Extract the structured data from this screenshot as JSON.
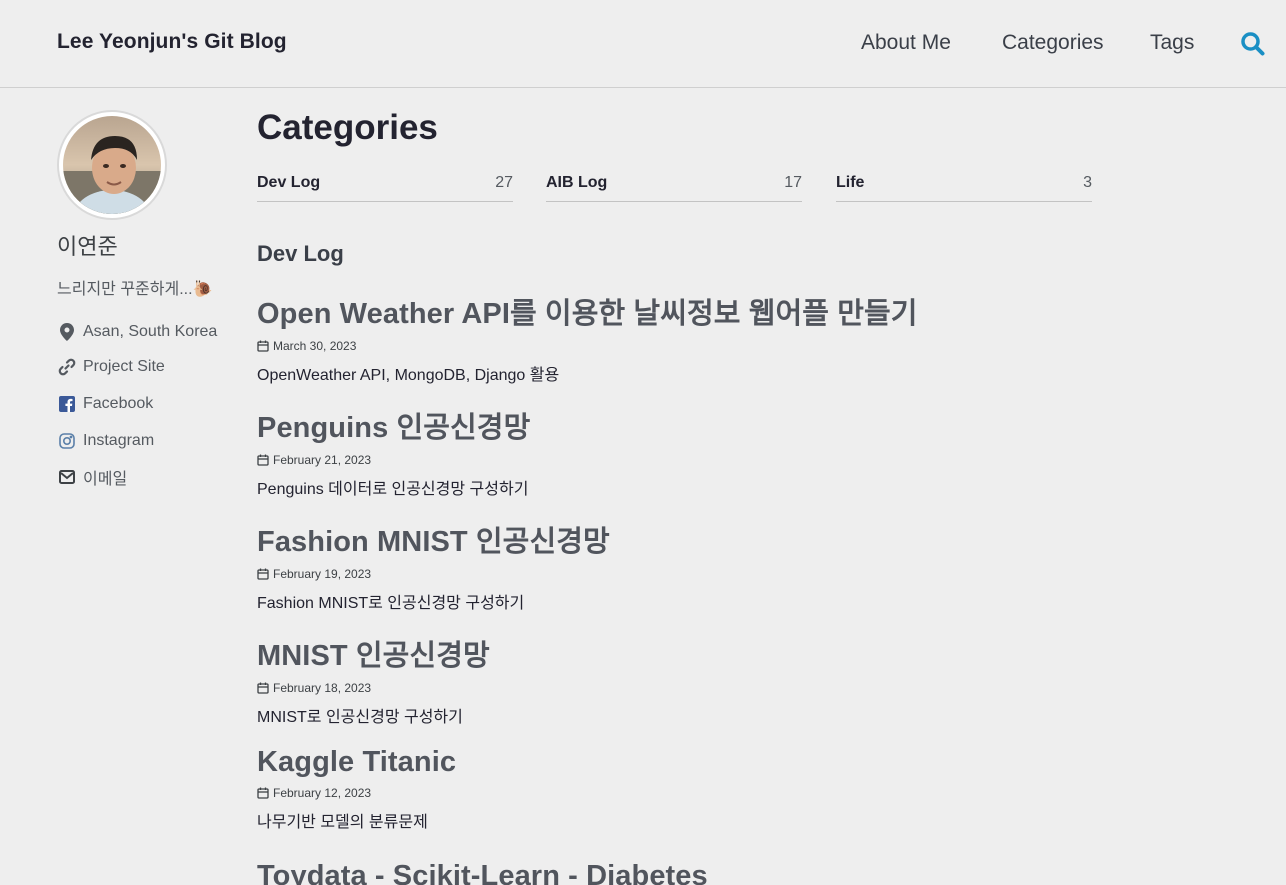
{
  "site": {
    "title": "Lee Yeonjun's Git Blog",
    "nav": [
      "About Me",
      "Categories",
      "Tags"
    ],
    "accent_color": "#1a8fc4"
  },
  "author": {
    "name": "이연준",
    "bio": "느리지만 꾸준하게...🐌",
    "links": [
      {
        "icon": "map-marker-icon",
        "label": "Asan, South Korea"
      },
      {
        "icon": "link-icon",
        "label": "Project Site"
      },
      {
        "icon": "facebook-icon",
        "label": "Facebook"
      },
      {
        "icon": "instagram-icon",
        "label": "Instagram"
      },
      {
        "icon": "envelope-icon",
        "label": "이메일"
      }
    ]
  },
  "page": {
    "title": "Categories",
    "categories": [
      {
        "name": "Dev Log",
        "count": "27"
      },
      {
        "name": "AIB Log",
        "count": "17"
      },
      {
        "name": "Life",
        "count": "3"
      }
    ],
    "section_title": "Dev Log",
    "posts": [
      {
        "title": "Open Weather API를 이용한 날씨정보 웹어플 만들기",
        "date": "March 30, 2023",
        "excerpt": "OpenWeather API, MongoDB, Django 활용"
      },
      {
        "title": "Penguins 인공신경망",
        "date": "February 21, 2023",
        "excerpt": "Penguins 데이터로 인공신경망 구성하기"
      },
      {
        "title": "Fashion MNIST 인공신경망",
        "date": "February 19, 2023",
        "excerpt": "Fashion MNIST로 인공신경망 구성하기"
      },
      {
        "title": "MNIST 인공신경망",
        "date": "February 18, 2023",
        "excerpt": "MNIST로 인공신경망 구성하기"
      },
      {
        "title": "Kaggle Titanic",
        "date": "February 12, 2023",
        "excerpt": "나무기반 모델의 분류문제"
      },
      {
        "title": "Toydata - Scikit-Learn - Diabetes",
        "date": "",
        "excerpt": ""
      }
    ]
  }
}
